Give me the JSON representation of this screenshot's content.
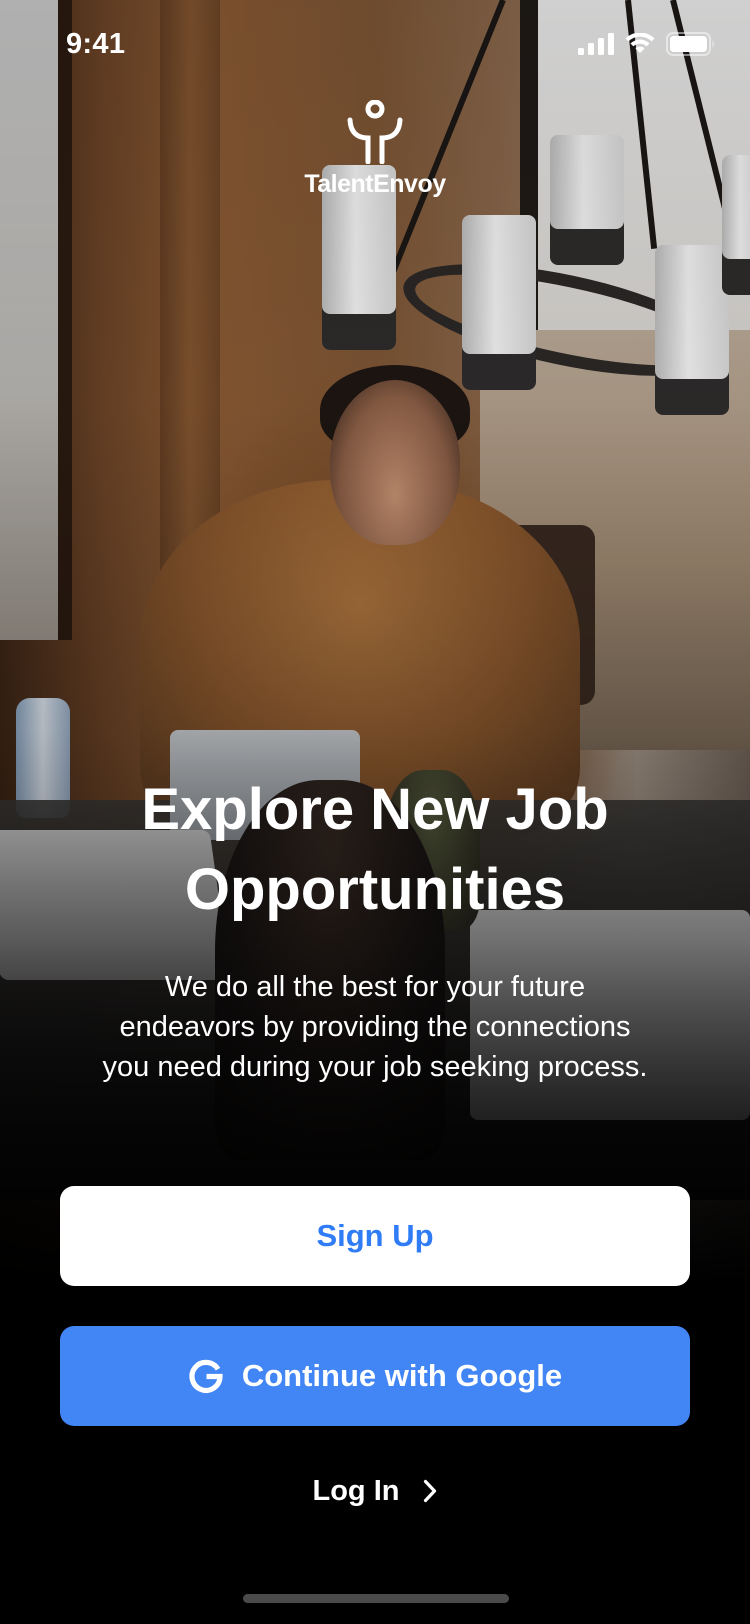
{
  "status_bar": {
    "time": "9:41",
    "icons": [
      "cellular-signal-icon",
      "wifi-icon",
      "battery-icon"
    ]
  },
  "brand": {
    "name": "TalentEnvoy",
    "logo_icon": "person-figure-logo"
  },
  "hero": {
    "headline_line1": "Explore New Job",
    "headline_line2": "Opportunities",
    "subtext_line1": "We do all the best for your future",
    "subtext_line2": "endeavors by providing the connections",
    "subtext_line3": "you need during your job seeking process."
  },
  "actions": {
    "signup_label": "Sign Up",
    "google_label": "Continue with Google",
    "login_label": "Log In"
  },
  "colors": {
    "accent_blue": "#4285f4",
    "signup_text": "#2f7cf6",
    "background": "#000000",
    "text": "#ffffff"
  }
}
